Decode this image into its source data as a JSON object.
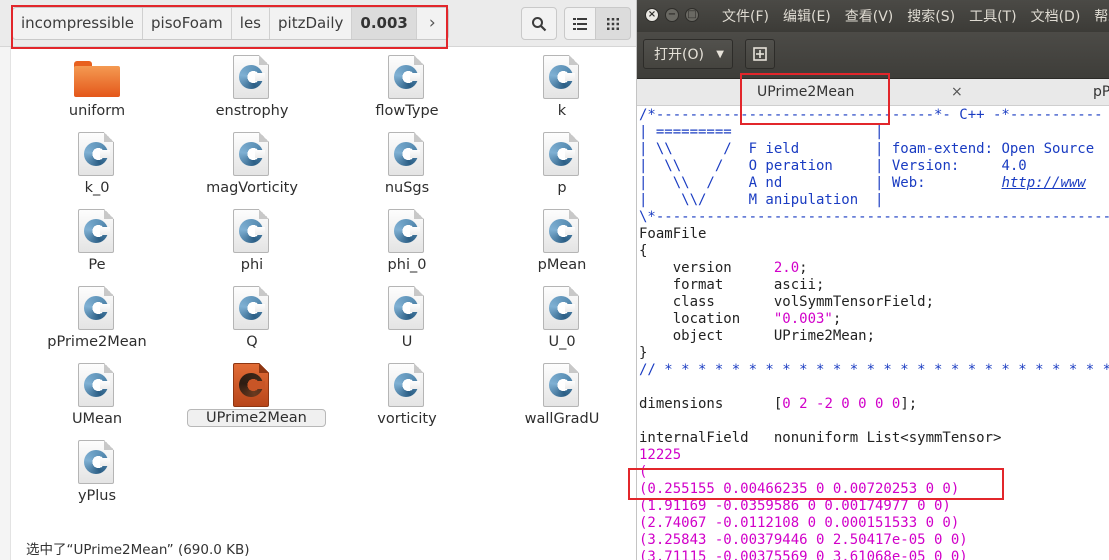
{
  "file_manager": {
    "breadcrumb": [
      "incompressible",
      "pisoFoam",
      "les",
      "pitzDaily",
      "0.003"
    ],
    "breadcrumb_more": "›",
    "files": [
      {
        "name": "uniform",
        "type": "folder"
      },
      {
        "name": "enstrophy",
        "type": "file"
      },
      {
        "name": "flowType",
        "type": "file"
      },
      {
        "name": "k",
        "type": "file"
      },
      {
        "name": "k_0",
        "type": "file"
      },
      {
        "name": "magVorticity",
        "type": "file"
      },
      {
        "name": "nuSgs",
        "type": "file"
      },
      {
        "name": "p",
        "type": "file"
      },
      {
        "name": "Pe",
        "type": "file"
      },
      {
        "name": "phi",
        "type": "file"
      },
      {
        "name": "phi_0",
        "type": "file"
      },
      {
        "name": "pMean",
        "type": "file"
      },
      {
        "name": "pPrime2Mean",
        "type": "file"
      },
      {
        "name": "Q",
        "type": "file"
      },
      {
        "name": "U",
        "type": "file"
      },
      {
        "name": "U_0",
        "type": "file"
      },
      {
        "name": "UMean",
        "type": "file"
      },
      {
        "name": "UPrime2Mean",
        "type": "file",
        "selected": true
      },
      {
        "name": "vorticity",
        "type": "file"
      },
      {
        "name": "wallGradU",
        "type": "file"
      },
      {
        "name": "yPlus",
        "type": "file"
      }
    ],
    "status": "选中了“UPrime2Mean” (690.0 KB)"
  },
  "editor": {
    "window_buttons": [
      "×",
      "−",
      "□"
    ],
    "menus": [
      "文件(F)",
      "编辑(E)",
      "查看(V)",
      "搜索(S)",
      "工具(T)",
      "文档(D)",
      "帮助(H)"
    ],
    "open_label": "打开(O)",
    "tab_active": "UPrime2Mean",
    "tab_close": "×",
    "tab_other": "pP",
    "code": {
      "l1": "/*---------------------------------*- C++ -*-----------",
      "l2a": "| =========                 |",
      "l2b": "",
      "l3a": "| \\\\      /  F ield         | ",
      "l3b": "foam-extend: Open Source",
      "l4a": "|  \\\\    /   O peration     | ",
      "l4b": "Version:     4.0",
      "l5a": "|   \\\\  /    A nd           | ",
      "l5b": "Web:         ",
      "l5link": "http://www",
      "l6": "|    \\\\/     M anipulation  |",
      "l7": "\\*------------------------------------------------------",
      "l8": "FoamFile",
      "l9": "{",
      "version_key": "    version     ",
      "version_val": "2.0",
      "version_end": ";",
      "format_line": "    format      ascii;",
      "class_line": "    class       volSymmTensorField;",
      "location_key": "    location    ",
      "location_val": "\"0.003\"",
      "location_end": ";",
      "object_line": "    object      UPrime2Mean;",
      "l15": "}",
      "l16": "// * * * * * * * * * * * * * * * * * * * * * * * * * * *",
      "dims_key": "dimensions      [",
      "dims_val": "0 2 -2 0 0 0 0",
      "dims_end": "];",
      "internal_line": "internalField   nonuniform List<symmTensor>",
      "count": "12225",
      "open_paren": "(",
      "rows": [
        "(0.255155 0.00466235 0 0.00720253 0 0)",
        "(1.91169 -0.0359586 0 0.00174977 0 0)",
        "(2.74067 -0.0112108 0 0.000151533 0 0)",
        "(3.25843 -0.00379446 0 2.50417e-05 0 0)",
        "(3.71115 -0.00375569 0 3.61068e-05 0 0)"
      ]
    }
  }
}
